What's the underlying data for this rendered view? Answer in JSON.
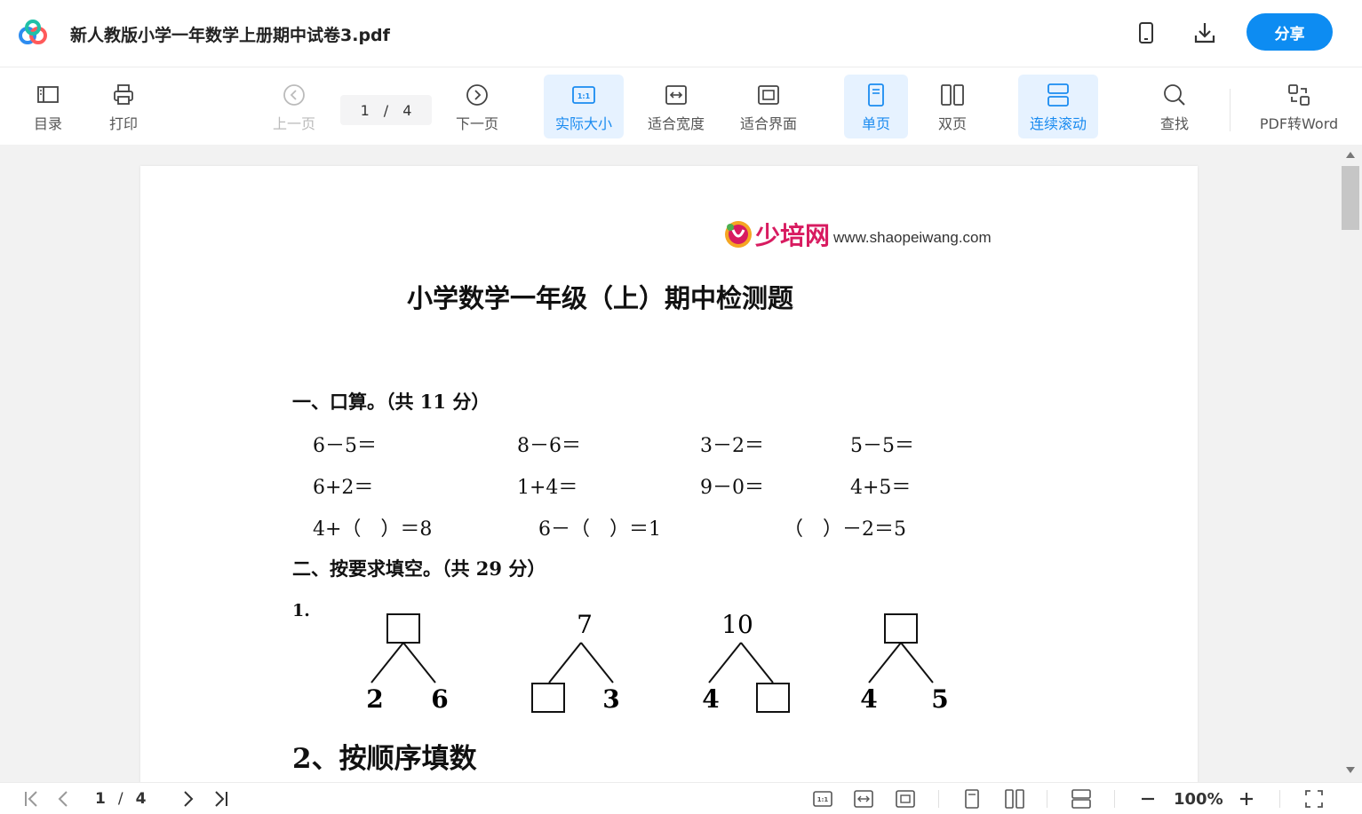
{
  "header": {
    "title": "新人教版小学一年数学上册期中试卷3.pdf",
    "share_label": "分享",
    "icons": [
      "app-logo-icon",
      "mobile-icon",
      "download-icon"
    ]
  },
  "toolbar": {
    "toc": "目录",
    "print": "打印",
    "prev": "上一页",
    "next": "下一页",
    "current_page": "1",
    "separator": "/",
    "total_pages": "4",
    "actual_size": "实际大小",
    "fit_width": "适合宽度",
    "fit_page": "适合界面",
    "single_page": "单页",
    "double_page": "双页",
    "continuous_scroll": "连续滚动",
    "search": "查找",
    "pdf_to_word": "PDF转Word",
    "accent_color": "#1a8bf0"
  },
  "document": {
    "brand_name": "少培网",
    "brand_url": "www.shaopeiwang.com",
    "title": "小学数学一年级（上）期中检测题",
    "section1": "一、口算。（共 11 分）",
    "equations": [
      [
        "6－5＝",
        "8－6＝",
        "3－2＝",
        "5－5＝"
      ],
      [
        "6+2＝",
        "1+4＝",
        "9－0＝",
        "4+5＝"
      ],
      [
        "4+（　）＝8",
        "6－（　）＝1",
        "（　）－2＝5"
      ]
    ],
    "section2": "二、按要求填空。（共 29 分）",
    "q1_label": "1.",
    "trees": [
      {
        "top": "",
        "left": "2",
        "right": "6"
      },
      {
        "top": "7",
        "left": "",
        "right": "3"
      },
      {
        "top": "10",
        "left": "4",
        "right": ""
      },
      {
        "top": "",
        "left": "4",
        "right": "5"
      }
    ],
    "section3": "2、按顺序填数"
  },
  "bottombar": {
    "current_page": "1",
    "separator": "/",
    "total_pages": "4",
    "zoom": "100%"
  }
}
